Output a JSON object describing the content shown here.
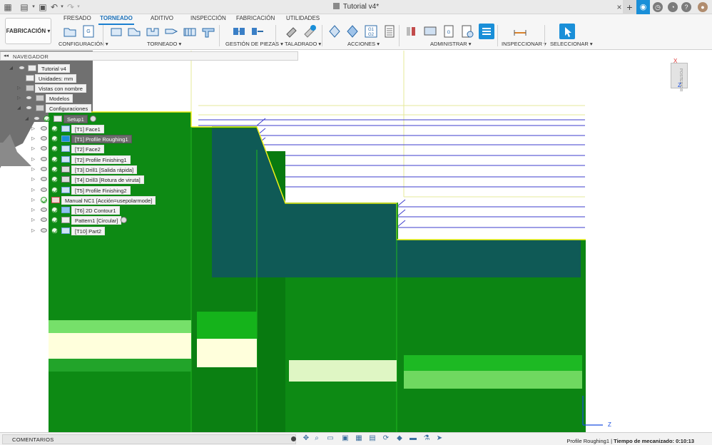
{
  "window": {
    "title": "Tutorial v4*"
  },
  "ribbon": {
    "workspace": "FABRICACIÓN",
    "tabs": [
      "FRESADO",
      "TORNEADO",
      "ADITIVO",
      "INSPECCIÓN",
      "FABRICACIÓN",
      "UTILIDADES"
    ],
    "active_tab": "TORNEADO",
    "groups": [
      "CONFIGURACIÓN ▾",
      "TORNEADO ▾",
      "GESTIÓN DE PIEZAS ▾",
      "TALADRADO ▾",
      "ACCIONES ▾",
      "ADMINISTRAR ▾",
      "INSPECCIONAR ▾",
      "SELECCIONAR ▾"
    ]
  },
  "browser": {
    "header": "NAVEGADOR",
    "root": "Tutorial v4",
    "units": "Unidades: mm",
    "named_views": "Vistas con nombre",
    "models": "Modelos",
    "setups": "Configuraciones",
    "setup": "Setup1",
    "operations": [
      "[T1] Face1",
      "[T1] Profile Roughing1",
      "[T2] Face2",
      "[T2] Profile Finishing1",
      "[T3] Drill1 [Salida rápida]",
      "[T4] Drill3 [Rotura de viruta]",
      "[T5] Profile Finishing2",
      "Manual NC1 [Acción=usepolarmode]",
      "[T6] 2D Contour1",
      "Pattern1 [Circular]",
      "[T10] Part2"
    ],
    "selected_operation": "[T1] Profile Roughing1"
  },
  "viewcube": {
    "face_label": "POSTERIOR",
    "axis_x": "X",
    "axis_z": "Z"
  },
  "canvas_axes": {
    "z": "Z"
  },
  "status": {
    "comments": "COMENTARIOS",
    "operation": "Profile Roughing1",
    "time_label": "Tiempo de mecanizado:",
    "time_value": "0:10:13"
  }
}
